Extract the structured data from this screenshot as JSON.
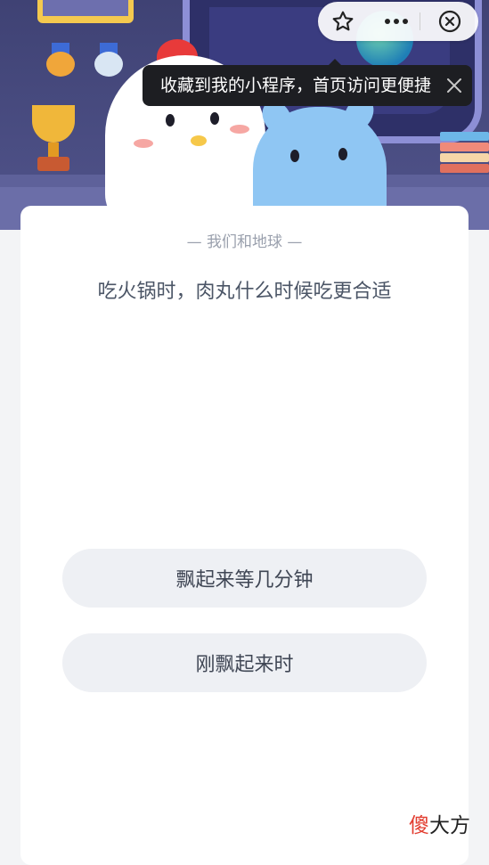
{
  "colors": {
    "hero_bg": "#4a4c7e",
    "card_bg": "#ffffff",
    "option_bg": "#eef0f4",
    "tooltip_bg": "#1d1e22",
    "watermark_red": "#e23b2e"
  },
  "capsule": {
    "favorite_icon": "star-icon",
    "more_icon": "more-dots-icon",
    "close_icon": "close-circle-icon"
  },
  "tooltip": {
    "text": "收藏到我的小程序，首页访问更便捷",
    "close_icon": "close-icon"
  },
  "quiz": {
    "subtitle": "— 我们和地球 —",
    "question": "吃火锅时，肉丸什么时候吃更合适",
    "options": [
      {
        "label": "飘起来等几分钟"
      },
      {
        "label": "刚飘起来时"
      }
    ]
  },
  "watermark": {
    "part1": "傻",
    "part2": "大方"
  }
}
